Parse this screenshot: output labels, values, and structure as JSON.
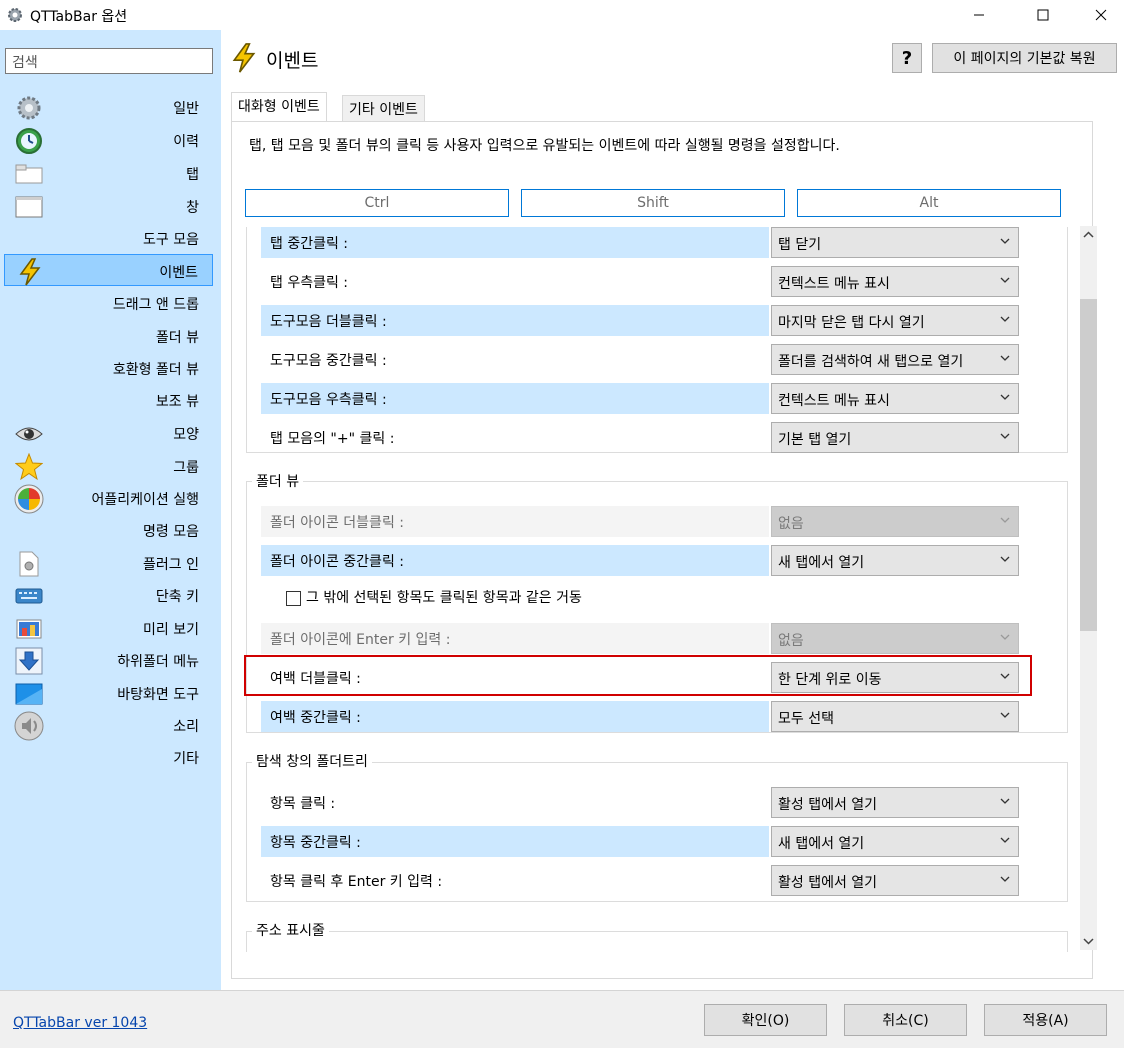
{
  "window": {
    "title": "QTTabBar 옵션"
  },
  "sidebar": {
    "search_placeholder": "검색",
    "items": [
      {
        "label": "일반",
        "icon": "gear-icon"
      },
      {
        "label": "이력",
        "icon": "history-icon"
      },
      {
        "label": "탭",
        "icon": "tab-icon"
      },
      {
        "label": "창",
        "icon": "window-icon"
      },
      {
        "label": "도구 모음",
        "icon": ""
      },
      {
        "label": "이벤트",
        "icon": "lightning-icon"
      },
      {
        "label": "드래그 앤 드롭",
        "icon": ""
      },
      {
        "label": "폴더 뷰",
        "icon": ""
      },
      {
        "label": "호환형 폴더 뷰",
        "icon": ""
      },
      {
        "label": "보조 뷰",
        "icon": ""
      },
      {
        "label": "모양",
        "icon": "eye-icon"
      },
      {
        "label": "그룹",
        "icon": "star-icon"
      },
      {
        "label": "어플리케이션 실행",
        "icon": "app-launcher-icon"
      },
      {
        "label": "명령 모음",
        "icon": ""
      },
      {
        "label": "플러그 인",
        "icon": "plugin-icon"
      },
      {
        "label": "단축 키",
        "icon": "keyboard-icon"
      },
      {
        "label": "미리 보기",
        "icon": "preview-icon"
      },
      {
        "label": "하위폴더 메뉴",
        "icon": "down-arrow-icon"
      },
      {
        "label": "바탕화면 도구",
        "icon": "desktop-icon"
      },
      {
        "label": "소리",
        "icon": "speaker-icon"
      },
      {
        "label": "기타",
        "icon": ""
      }
    ],
    "selected": "이벤트"
  },
  "main": {
    "title": "이벤트",
    "help_label": "?",
    "restore_label": "이 페이지의 기본값 복원",
    "tabs": [
      {
        "label": "대화형 이벤트",
        "active": true
      },
      {
        "label": "기타 이벤트",
        "active": false
      }
    ],
    "description": "탭, 탭 모음 및 폴더 뷰의 클릭 등 사용자 입력으로 유발되는 이벤트에 따라 실행될 명령을 설정합니다.",
    "modifiers": [
      "Ctrl",
      "Shift",
      "Alt"
    ],
    "tab_section": {
      "rows": [
        {
          "label": "탭 중간클릭 :",
          "value": "탭 닫기"
        },
        {
          "label": "탭 우측클릭 :",
          "value": "컨텍스트 메뉴 표시"
        },
        {
          "label": "도구모음 더블클릭 :",
          "value": "마지막 닫은 탭 다시 열기"
        },
        {
          "label": "도구모음 중간클릭 :",
          "value": "폴더를 검색하여 새 탭으로 열기"
        },
        {
          "label": "도구모음 우측클릭 :",
          "value": "컨텍스트 메뉴 표시"
        },
        {
          "label": "탭 모음의 \"+\" 클릭 :",
          "value": "기본 탭 열기"
        }
      ]
    },
    "folder_view": {
      "title": "폴더 뷰",
      "rows": [
        {
          "label": "폴더 아이콘 더블클릭 :",
          "value": "없음",
          "disabled": true
        },
        {
          "label": "폴더 아이콘 중간클릭 :",
          "value": "새 탭에서 열기",
          "disabled": false
        },
        {
          "label": "폴더 아이콘에 Enter 키 입력 :",
          "value": "없음",
          "disabled": true
        },
        {
          "label": "여백 더블클릭 :",
          "value": "한 단계 위로 이동",
          "disabled": false,
          "highlighted": true
        },
        {
          "label": "여백 중간클릭 :",
          "value": "모두 선택",
          "disabled": false
        }
      ],
      "checkbox_label": "그 밖에 선택된 항목도 클릭된 항목과 같은 거동",
      "checkbox_checked": false
    },
    "tree_section": {
      "title": "탐색 창의 폴더트리",
      "rows": [
        {
          "label": "항목 클릭 :",
          "value": "활성 탭에서 열기"
        },
        {
          "label": "항목 중간클릭 :",
          "value": "새 탭에서 열기"
        },
        {
          "label": "항목 클릭 후 Enter 키 입력 :",
          "value": "활성 탭에서 열기"
        }
      ]
    },
    "address_section": {
      "title": "주소 표시줄"
    }
  },
  "footer": {
    "version": "QTTabBar ver 1043",
    "ok": "확인(O)",
    "cancel": "취소(C)",
    "apply": "적용(A)"
  },
  "colors": {
    "sidebar_bg": "#cce8ff",
    "selected_bg": "#99d1ff",
    "highlight_border": "#d00000",
    "accent": "#0078d7"
  }
}
